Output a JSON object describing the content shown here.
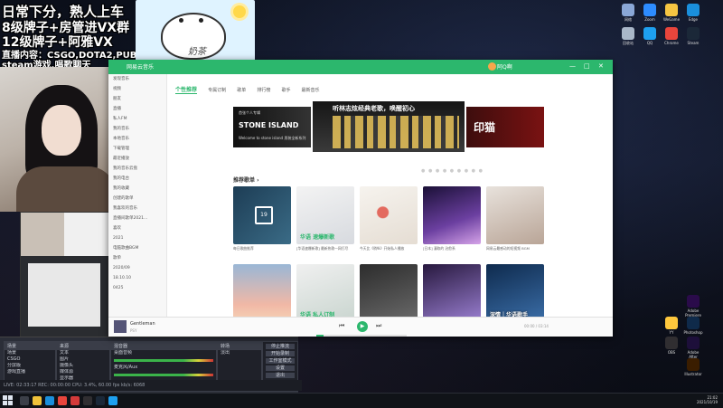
{
  "overlay": {
    "line1": "日常下分，熟人上车",
    "line2": "8级牌子+房管进VX群",
    "line3": "12级牌子+阿雅VX",
    "line4": "直播内容：CSGO,DOTA2,PUBG",
    "line5": "steam游戏,唱歌聊天",
    "cat_text": "奶茶"
  },
  "music_app": {
    "brand": "网易云音乐",
    "user": "阿Q啊",
    "window_controls": [
      "—",
      "□",
      "✕"
    ],
    "tabs": [
      "个性推荐",
      "专属订制",
      "歌单",
      "排行榜",
      "歌手",
      "最新音乐"
    ],
    "active_tab": "个性推荐",
    "sidebar": [
      "发现音乐",
      "视频",
      "朋友",
      "直播",
      "私人FM",
      "我的音乐",
      "本地音乐",
      "下载管理",
      "最近播放",
      "我的音乐云盘",
      "我的电台",
      "我的收藏",
      "创建的歌单",
      "我喜欢的音乐",
      "直播间歌单2021...",
      "喜欢",
      "2021",
      "电脑歌曲BGM",
      "歌单",
      "2020/09",
      "18.10.10",
      "0425"
    ],
    "banners": {
      "left_title": "STONE ISLAND",
      "left_sub": "Welcome to stone island 男装全新系列",
      "left_tag": "首张个人专辑",
      "center_title": "听林志炫经典老歌，唤醒初心",
      "right_title": "印猫"
    },
    "section_title": "推荐歌单",
    "section_arrow": "›",
    "carousel_dots": "● ● ● ● ● ● ● ● ●",
    "playlists": [
      {
        "caption": "每日歌曲推荐",
        "overlay": "",
        "calendar": "19"
      },
      {
        "caption": "[华语速爆新歌] 最新热歌一网打尽",
        "overlay": "华语 速爆新歌"
      },
      {
        "caption": "今天比《稍纵》开始私人播放",
        "overlay": ""
      },
      {
        "caption": "[日本] 漫取的 治愈系",
        "overlay": ""
      },
      {
        "caption": "网易云最感动的短视频 BGM",
        "overlay": ""
      },
      {
        "caption": "来自雾霭的 | 那些温暖的故事",
        "overlay": ""
      },
      {
        "caption": "天天之音 | 华语私人订制",
        "overlay": "华语 私人订制"
      },
      {
        "caption": "[宝马·蓝鸟一人] 超短",
        "overlay": ""
      },
      {
        "caption": "伴随ACG歌曲",
        "overlay": ""
      },
      {
        "caption": "深情｜华语歌手",
        "overlay": "深情｜华语歌手"
      }
    ],
    "player": {
      "song": "Gentleman",
      "artist": "PSY",
      "prev": "⏮",
      "next": "⏭",
      "play": "▶",
      "time": "00:00 / 03:14",
      "progress": 0.08
    }
  },
  "obs": {
    "scenes_title": "场景",
    "scenes": [
      "场景",
      "CSGO",
      "分屏版",
      "游戏直播"
    ],
    "sources_title": "来源",
    "sources": [
      "文本",
      "图片",
      "摄像头",
      "媒体源",
      "显示器"
    ],
    "mixer_title": "混音器",
    "mixer": [
      "桌面音频",
      "麦克风/Aux"
    ],
    "transitions_title": "转场",
    "transition": "淡出",
    "controls": [
      "停止推流",
      "开始录制",
      "工作室模式",
      "设置",
      "退出"
    ],
    "status": "LIVE: 02:33:17  REC: 00:00:00  CPU: 3.4%, 60.00 fps  kb/s: 6068"
  },
  "desktop_icons": [
    "网络",
    "回收站",
    "Zoom",
    "QQ",
    "Chrome",
    "Edge",
    "Steam",
    "WeGame",
    "YY",
    "OBS",
    "Adobe Premiere",
    "Adobe After Effects",
    "Photoshop",
    "Illustrator"
  ],
  "taskbar": {
    "clock": "21:02",
    "date": "2021/10/19"
  },
  "colors": {
    "accent": "#2cb76d"
  }
}
